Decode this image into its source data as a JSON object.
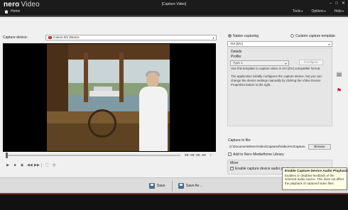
{
  "window": {
    "brand": "nero",
    "app_name": "Video",
    "title": "[Capture Video]",
    "controls": [
      "minimize-icon",
      "maximize-icon",
      "close-icon"
    ]
  },
  "nav": {
    "home": "Home",
    "menu": [
      "Tools",
      "Options",
      "Help"
    ]
  },
  "capture": {
    "device_label": "Capture device:",
    "device_value": "Canon DV Device",
    "timecode": "00:00:00.00",
    "timeline_position_percent": 0
  },
  "settings": {
    "native_label": "Native capturing",
    "custom_label": "Custom capture template",
    "native_selected": true,
    "format_value": "AVI (DV)",
    "details_label": "Details",
    "profile_label": "Profile:",
    "profile_value": "Type 1",
    "configure_label": "Configure",
    "template_desc": "Use this template to capture video in AVI (DV) compatible format.",
    "app_desc": "The application initially configures the capture device, but you can change the device settings manually by clicking the Video Device Properties button to the right."
  },
  "output": {
    "capture_to_label": "Capture to file:",
    "file_path": "G:\\Documents\\Nero\\Video\\Captured\\Video\\AVICapture.avi",
    "browse_label": "Browse",
    "add_mediahome_label": "Add to Nero MediaHome Library",
    "add_mediahome_checked": false,
    "more_label": "More",
    "audio_playback_label": "Enable capture device audio playback",
    "audio_playback_checked": true
  },
  "tooltip": {
    "title": "Enable Capture Device Audio Playback",
    "body": "Enables or disables feedback of the selected audio source. This does not affect the playback of captured video files."
  },
  "footer": {
    "save_label": "Save",
    "save_as_label": "Save As ..."
  },
  "colors": {
    "titlebar": "#1b1b1b",
    "accent_red": "#c8102e",
    "panel": "#e6e6e6"
  }
}
